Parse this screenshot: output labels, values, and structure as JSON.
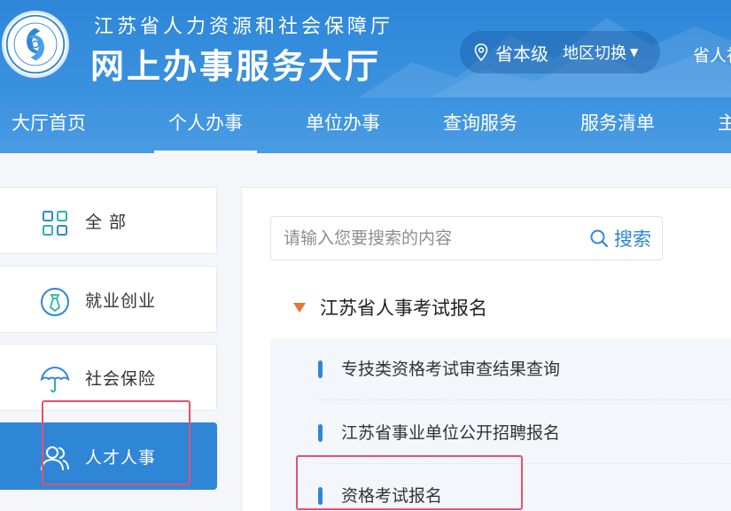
{
  "header": {
    "org_name": "江苏省人力资源和社会保障厅",
    "hall_name": "网上办事服务大厅",
    "logo_text": "江苏省人力资源和社会保障厅",
    "region": {
      "current": "省本级",
      "switch_label": "地区切换"
    },
    "right_text": "省人社"
  },
  "nav": {
    "items": [
      {
        "label": "大厅首页"
      },
      {
        "label": "个人办事"
      },
      {
        "label": "单位办事"
      },
      {
        "label": "查询服务"
      },
      {
        "label": "服务清单"
      },
      {
        "label": "主"
      }
    ],
    "active_index": 1
  },
  "sidebar": {
    "categories": [
      {
        "label": "全 部",
        "icon": "grid-icon"
      },
      {
        "label": "就业创业",
        "icon": "tie-icon"
      },
      {
        "label": "社会保险",
        "icon": "umbrella-icon"
      },
      {
        "label": "人才人事",
        "icon": "people-icon"
      }
    ],
    "active_index": 3
  },
  "search": {
    "placeholder": "请输入您要搜索的内容",
    "value": "",
    "button_label": "搜索"
  },
  "section": {
    "title": "江苏省人事考试报名",
    "items": [
      {
        "label": "专技类资格考试审查结果查询"
      },
      {
        "label": "江苏省事业单位公开招聘报名"
      },
      {
        "label": "资格考试报名"
      }
    ]
  },
  "colors": {
    "primary": "#2f86d7",
    "header_top": "#2e86d9",
    "accent_triangle": "#e87530",
    "highlight": "#e8506a"
  }
}
